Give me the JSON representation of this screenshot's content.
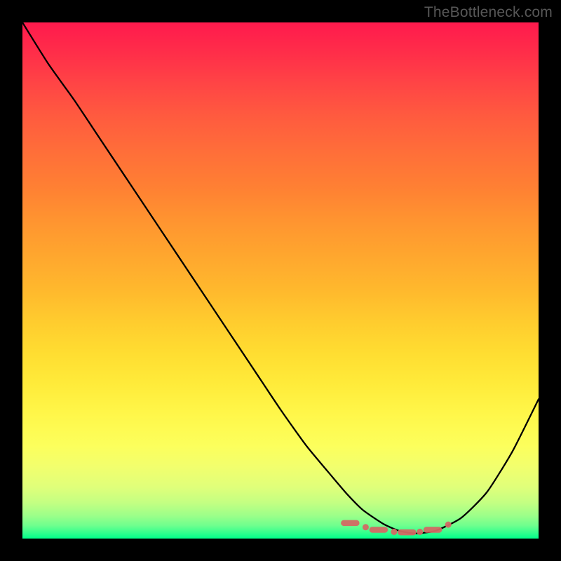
{
  "attribution": "TheBottleneck.com",
  "chart_data": {
    "type": "line",
    "title": "",
    "xlabel": "",
    "ylabel": "",
    "xlim": [
      0,
      100
    ],
    "ylim": [
      0,
      100
    ],
    "grid": false,
    "legend": false,
    "background_gradient": {
      "orientation": "vertical",
      "stops": [
        {
          "pos": 0,
          "color": "#ff1a4d"
        },
        {
          "pos": 50,
          "color": "#ffcc2e"
        },
        {
          "pos": 80,
          "color": "#fcff5c"
        },
        {
          "pos": 100,
          "color": "#00ff8a"
        }
      ]
    },
    "series": [
      {
        "name": "bottleneck-curve",
        "color": "#000000",
        "x": [
          0,
          5,
          10,
          15,
          20,
          25,
          30,
          35,
          40,
          45,
          50,
          55,
          60,
          63,
          66,
          70,
          73,
          76,
          80,
          85,
          90,
          95,
          100
        ],
        "y": [
          100,
          92,
          85,
          77.5,
          70,
          62.5,
          55,
          47.5,
          40,
          32.5,
          25,
          18,
          12,
          8.5,
          5.5,
          2.8,
          1.5,
          1,
          1.5,
          4,
          9,
          17,
          27
        ]
      }
    ],
    "minimum_markers": {
      "color": "#d36a64",
      "points": [
        {
          "x": 63.5,
          "y": 3.0,
          "shape": "dash"
        },
        {
          "x": 66.5,
          "y": 2.2,
          "shape": "dot"
        },
        {
          "x": 69.0,
          "y": 1.7,
          "shape": "dash"
        },
        {
          "x": 72.0,
          "y": 1.3,
          "shape": "dot"
        },
        {
          "x": 74.5,
          "y": 1.2,
          "shape": "dash"
        },
        {
          "x": 77.0,
          "y": 1.3,
          "shape": "dot"
        },
        {
          "x": 79.5,
          "y": 1.7,
          "shape": "dash"
        },
        {
          "x": 82.5,
          "y": 2.7,
          "shape": "dot"
        }
      ]
    }
  }
}
